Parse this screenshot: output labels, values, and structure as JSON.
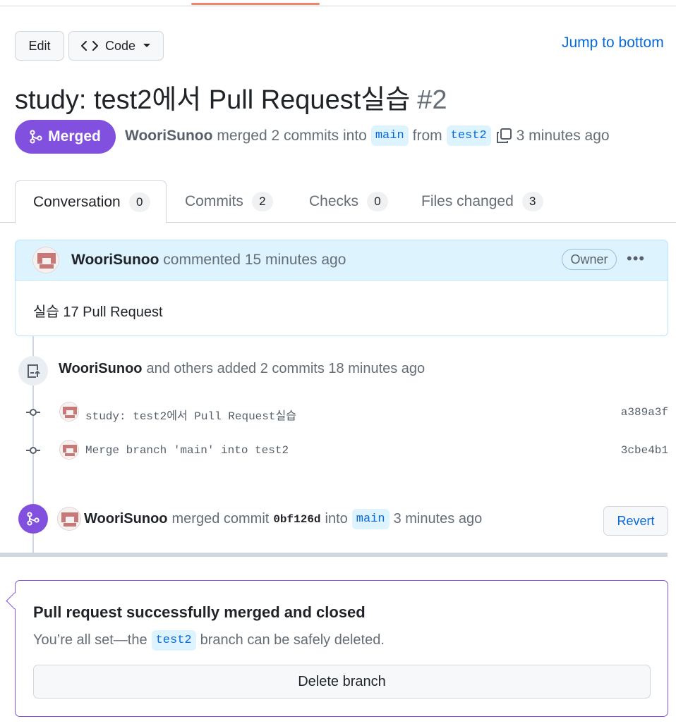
{
  "toolbar": {
    "edit_label": "Edit",
    "code_label": "Code",
    "jump_label": "Jump to bottom"
  },
  "pr": {
    "title": "study: test2에서 Pull Request실습",
    "number": "#2",
    "state_label": "Merged",
    "author": "WooriSunoo",
    "merged_text": "merged 2 commits into",
    "base_branch": "main",
    "from_text": "from",
    "head_branch": "test2",
    "time": "3 minutes ago"
  },
  "tabs": [
    {
      "label": "Conversation",
      "count": "0"
    },
    {
      "label": "Commits",
      "count": "2"
    },
    {
      "label": "Checks",
      "count": "0"
    },
    {
      "label": "Files changed",
      "count": "3"
    }
  ],
  "comment": {
    "author": "WooriSunoo",
    "action": "commented 15 minutes ago",
    "role": "Owner",
    "more": "•••",
    "body": "실습 17 Pull Request"
  },
  "push_event": {
    "author": "WooriSunoo",
    "text": "and others added 2 commits 18 minutes ago",
    "commits": [
      {
        "message": "study: test2에서 Pull Request실습",
        "sha": "a389a3f"
      },
      {
        "message": "Merge branch 'main' into test2",
        "sha": "3cbe4b1"
      }
    ]
  },
  "merge_event": {
    "author": "WooriSunoo",
    "text": "merged commit",
    "commit": "0bf126d",
    "into": "into",
    "branch": "main",
    "time": "3 minutes ago",
    "revert_label": "Revert"
  },
  "merge_box": {
    "title": "Pull request successfully merged and closed",
    "sub_prefix": "You’re all set—the",
    "branch": "test2",
    "sub_suffix": "branch can be safely deleted.",
    "delete_label": "Delete branch"
  },
  "colors": {
    "merged": "#8250df",
    "link": "#0969da",
    "accent": "#f0856e",
    "comment_header": "#ddf4ff"
  },
  "icons": [
    "code-icon",
    "caret-down-icon",
    "git-merge-icon",
    "copy-icon",
    "kebab-icon",
    "repo-push-icon",
    "git-commit-icon"
  ]
}
